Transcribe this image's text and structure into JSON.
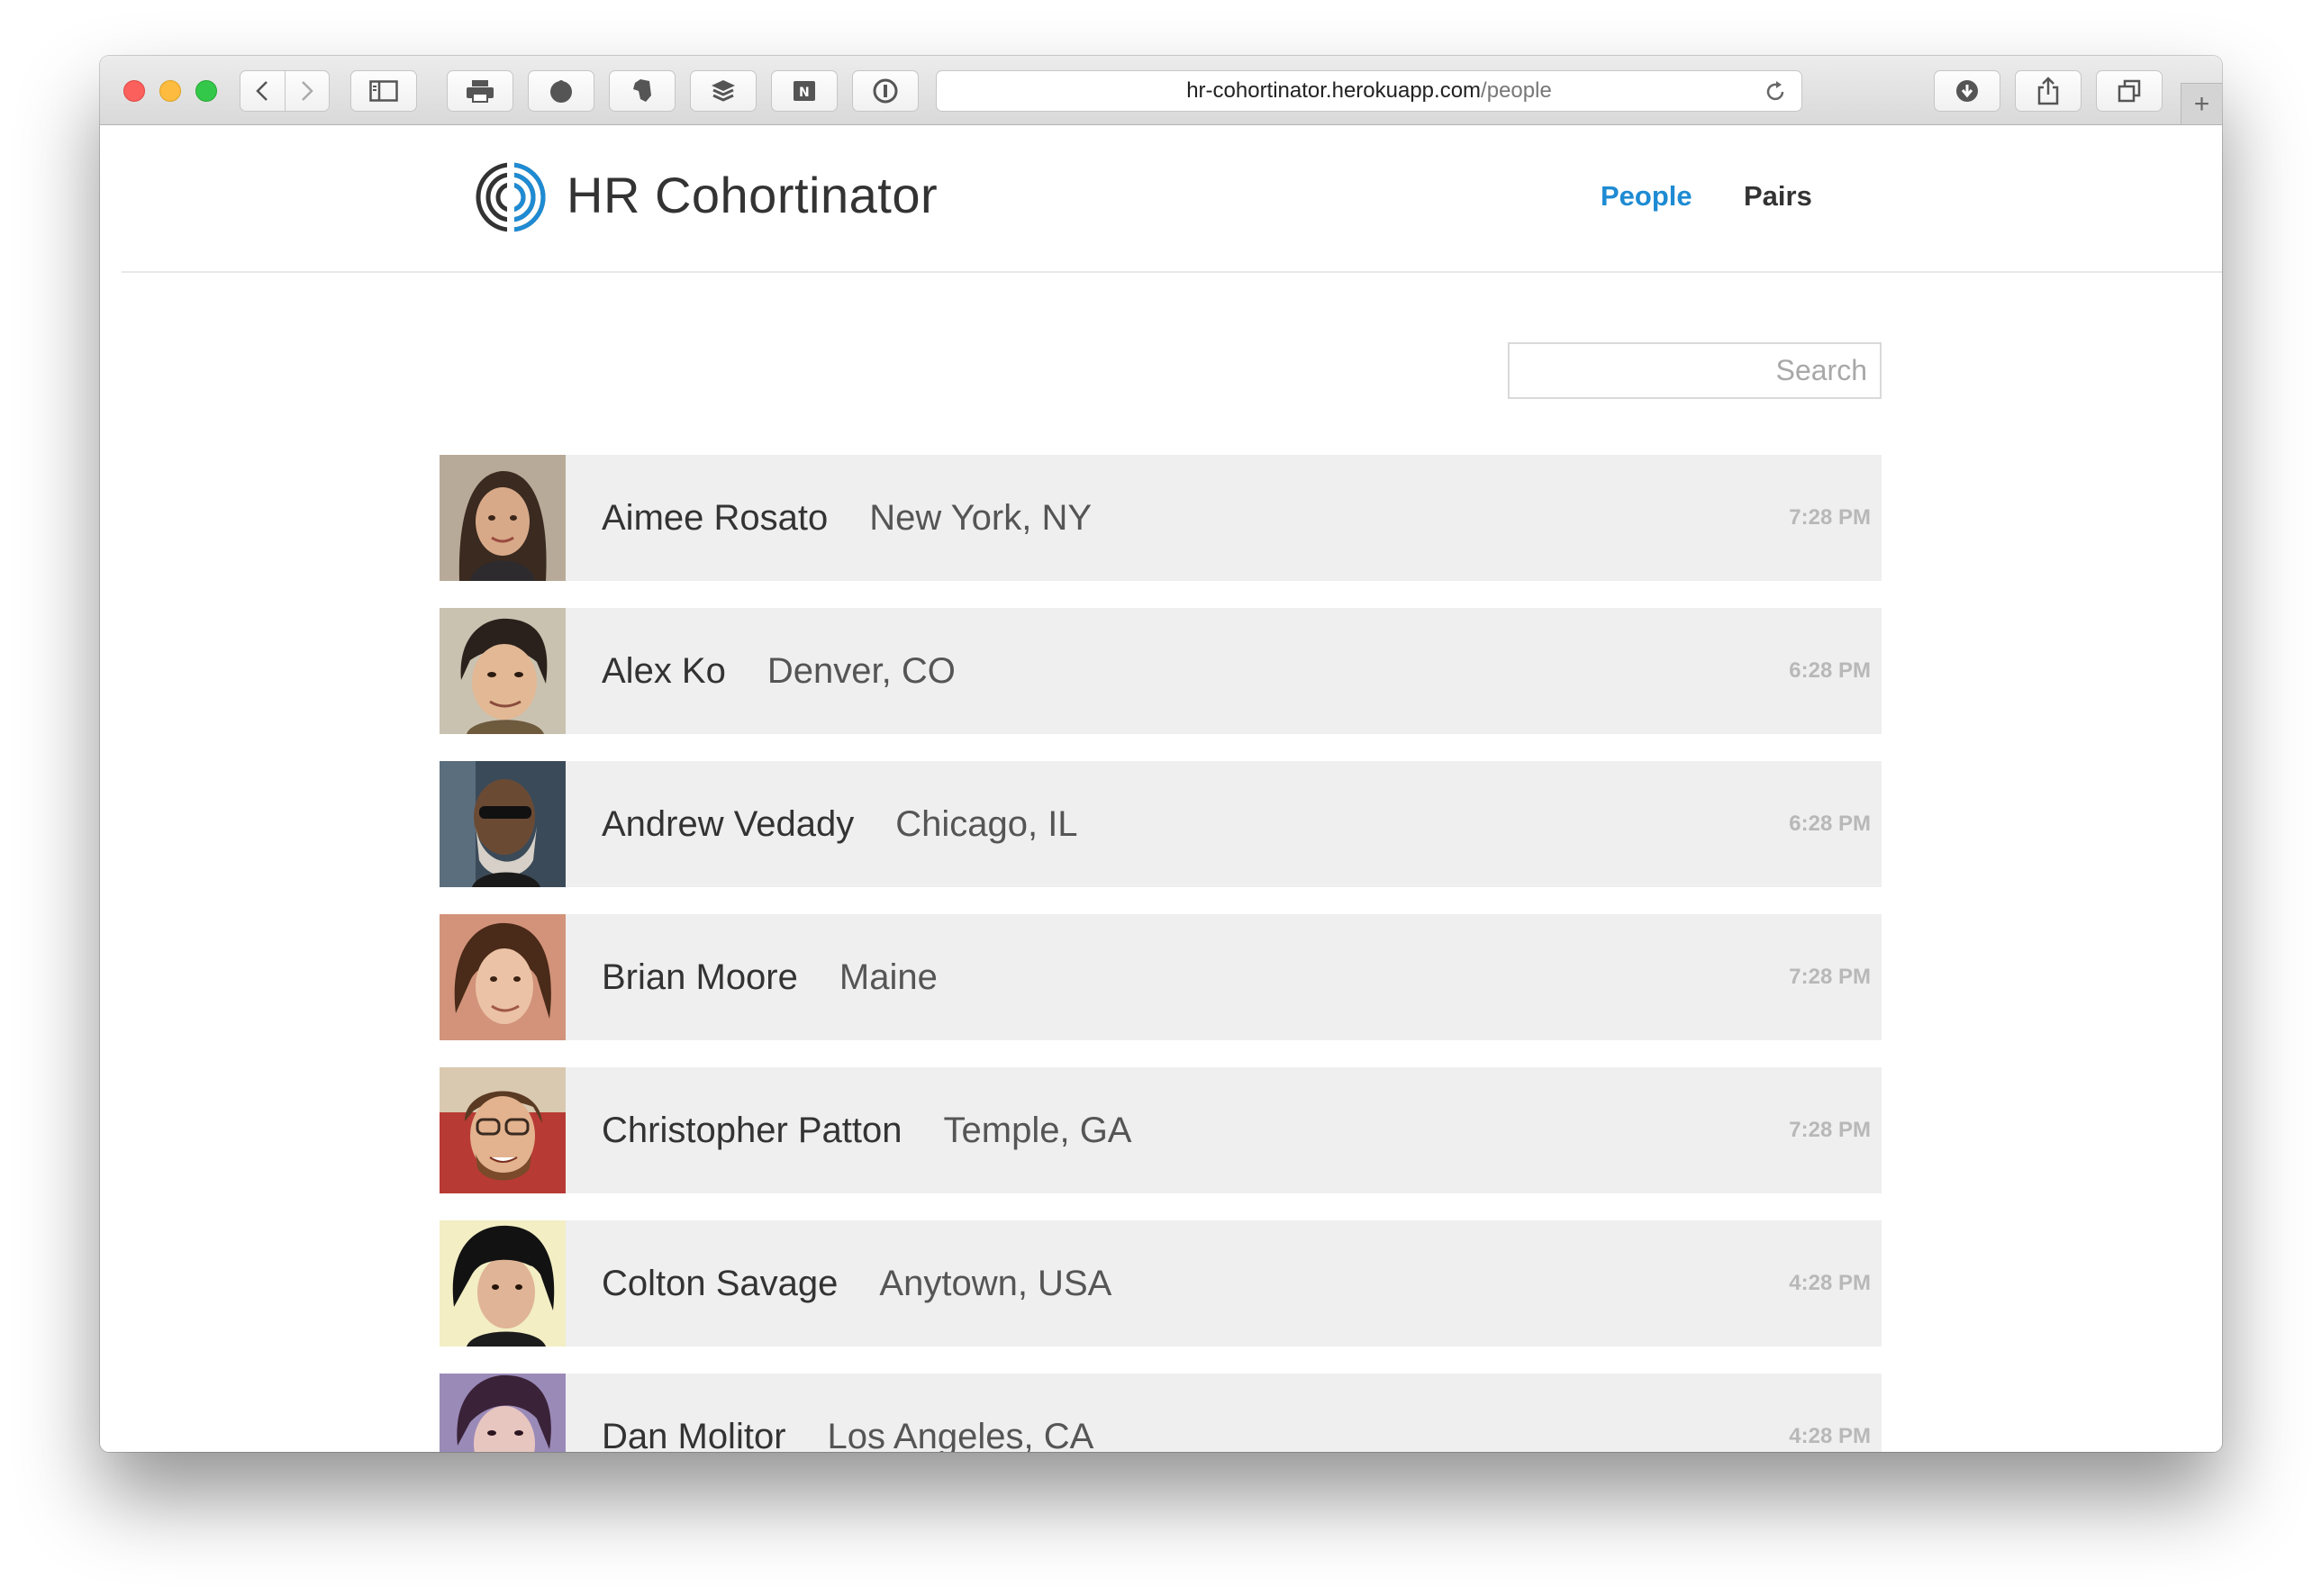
{
  "browser": {
    "url_host": "hr-cohortinator.herokuapp.com",
    "url_path": "/people",
    "icons": [
      "back-icon",
      "forward-icon",
      "sidebar-icon",
      "print-icon",
      "extension-icon",
      "evernote-icon",
      "buffer-icon",
      "onenote-icon",
      "1password-icon",
      "reload-icon",
      "downloads-icon",
      "share-icon",
      "tabs-icon",
      "new-tab-icon"
    ]
  },
  "site": {
    "brand": "HR Cohortinator",
    "nav": [
      {
        "label": "People",
        "active": true
      },
      {
        "label": "Pairs",
        "active": false
      }
    ],
    "accent_color": "#1e8bd3"
  },
  "search": {
    "placeholder": "Search",
    "value": ""
  },
  "people": [
    {
      "name": "Aimee Rosato",
      "location": "New York, NY",
      "time": "7:28 PM"
    },
    {
      "name": "Alex Ko",
      "location": "Denver, CO",
      "time": "6:28 PM"
    },
    {
      "name": "Andrew Vedady",
      "location": "Chicago, IL",
      "time": "6:28 PM"
    },
    {
      "name": "Brian Moore",
      "location": "Maine",
      "time": "7:28 PM"
    },
    {
      "name": "Christopher Patton",
      "location": "Temple, GA",
      "time": "7:28 PM"
    },
    {
      "name": "Colton Savage",
      "location": "Anytown, USA",
      "time": "4:28 PM"
    },
    {
      "name": "Dan Molitor",
      "location": "Los Angeles, CA",
      "time": "4:28 PM"
    }
  ]
}
